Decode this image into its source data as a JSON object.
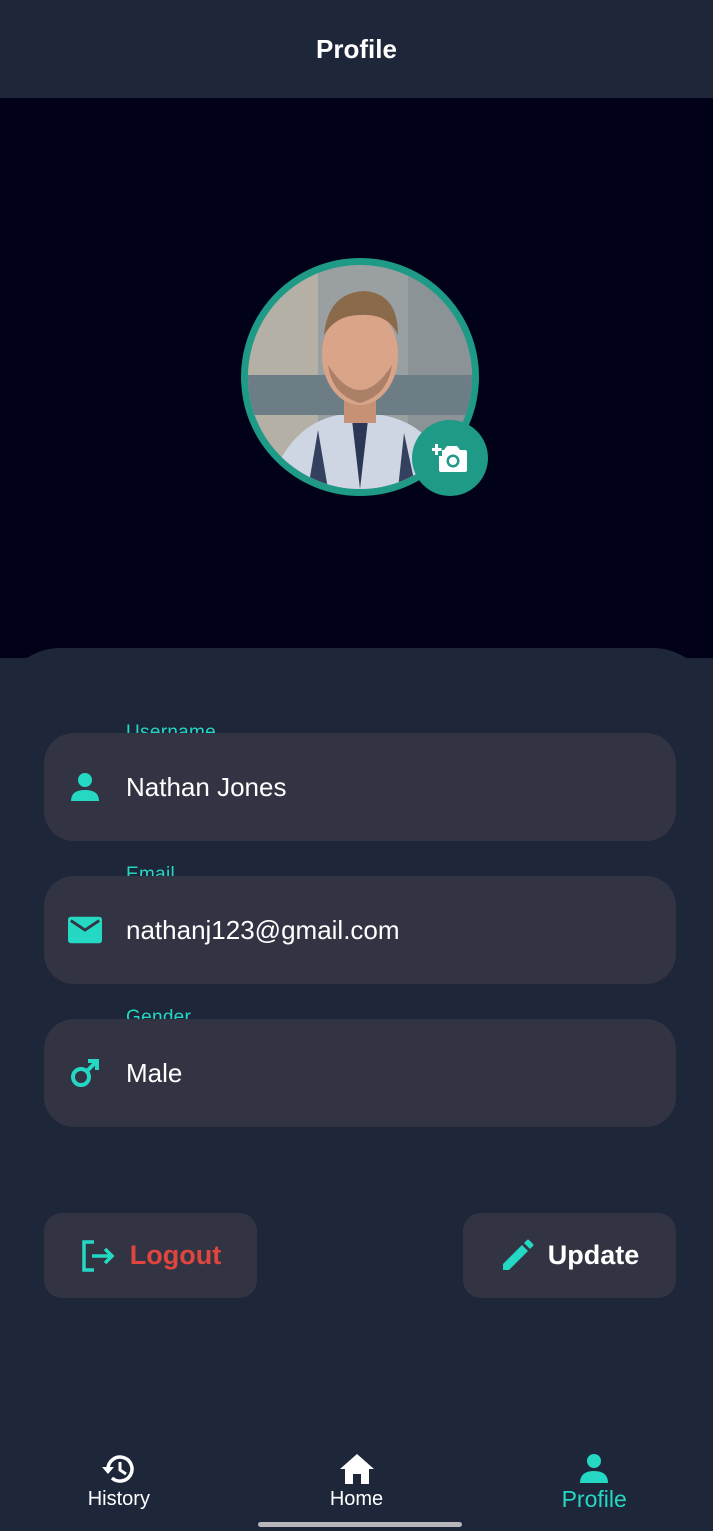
{
  "header": {
    "title": "Profile"
  },
  "colors": {
    "accent": "#25d8c3",
    "ring": "#1e9a86",
    "danger": "#e0463f",
    "field_bg": "#323443",
    "page_bg": "#1e2639",
    "hero_bg": "#01021a"
  },
  "avatar": {
    "icon": "add-a-photo-icon"
  },
  "fields": [
    {
      "label": "Username",
      "value": "Nathan Jones",
      "icon": "person-icon"
    },
    {
      "label": "Email",
      "value": "nathanj123@gmail.com",
      "icon": "mail-icon"
    },
    {
      "label": "Gender",
      "value": "Male",
      "icon": "male-icon"
    }
  ],
  "actions": {
    "logout_label": "Logout",
    "logout_icon": "logout-icon",
    "update_label": "Update",
    "update_icon": "edit-pencil-icon"
  },
  "nav": [
    {
      "label": "History",
      "icon": "history-icon",
      "active": false
    },
    {
      "label": "Home",
      "icon": "home-icon",
      "active": false
    },
    {
      "label": "Profile",
      "icon": "person-icon",
      "active": true
    }
  ]
}
